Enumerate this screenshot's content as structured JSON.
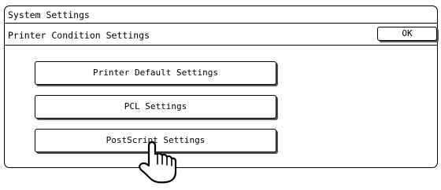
{
  "window": {
    "title": "System Settings",
    "subtitle": "Printer Condition Settings"
  },
  "toolbar": {
    "ok_label": "OK"
  },
  "menu": {
    "items": [
      {
        "label": "Printer Default Settings"
      },
      {
        "label": "PCL Settings"
      },
      {
        "label": "PostScript Settings"
      }
    ]
  },
  "icons": {
    "cursor": "pointing-hand-icon"
  }
}
